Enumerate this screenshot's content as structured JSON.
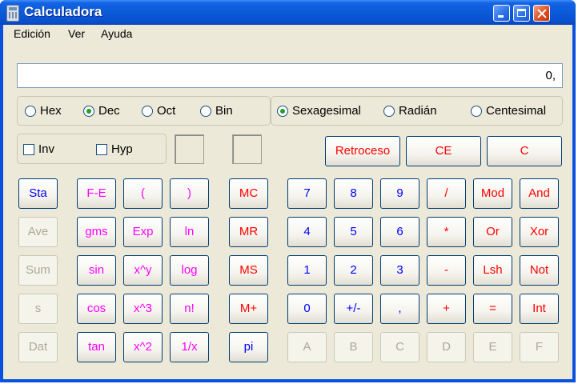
{
  "window": {
    "title": "Calculadora"
  },
  "menu": [
    "Edición",
    "Ver",
    "Ayuda"
  ],
  "display": {
    "value": "0,"
  },
  "base_radios": [
    {
      "label": "Hex",
      "checked": false
    },
    {
      "label": "Dec",
      "checked": true
    },
    {
      "label": "Oct",
      "checked": false
    },
    {
      "label": "Bin",
      "checked": false
    }
  ],
  "angle_radios": [
    {
      "label": "Sexagesimal",
      "checked": true
    },
    {
      "label": "Radián",
      "checked": false
    },
    {
      "label": "Centesimal",
      "checked": false
    }
  ],
  "checks": [
    {
      "label": "Inv",
      "checked": false
    },
    {
      "label": "Hyp",
      "checked": false
    }
  ],
  "edit_buttons": {
    "backspace": "Retroceso",
    "ce": "CE",
    "c": "C"
  },
  "stat_buttons": [
    "Sta",
    "Ave",
    "Sum",
    "s",
    "Dat"
  ],
  "sci_buttons": [
    [
      "F-E",
      "(",
      ")"
    ],
    [
      "gms",
      "Exp",
      "ln"
    ],
    [
      "sin",
      "x^y",
      "log"
    ],
    [
      "cos",
      "x^3",
      "n!"
    ],
    [
      "tan",
      "x^2",
      "1/x"
    ]
  ],
  "mem_buttons": [
    "MC",
    "MR",
    "MS",
    "M+",
    "pi"
  ],
  "num_buttons": [
    [
      "7",
      "8",
      "9",
      "/",
      "Mod",
      "And"
    ],
    [
      "4",
      "5",
      "6",
      "*",
      "Or",
      "Xor"
    ],
    [
      "1",
      "2",
      "3",
      "-",
      "Lsh",
      "Not"
    ],
    [
      "0",
      "+/-",
      ",",
      "+",
      "=",
      "Int"
    ],
    [
      "A",
      "B",
      "C",
      "D",
      "E",
      "F"
    ]
  ],
  "colors": {
    "blue": "#0000ff",
    "red": "#ff0000",
    "magenta": "#ff00ff",
    "disabled": "#aca899"
  }
}
